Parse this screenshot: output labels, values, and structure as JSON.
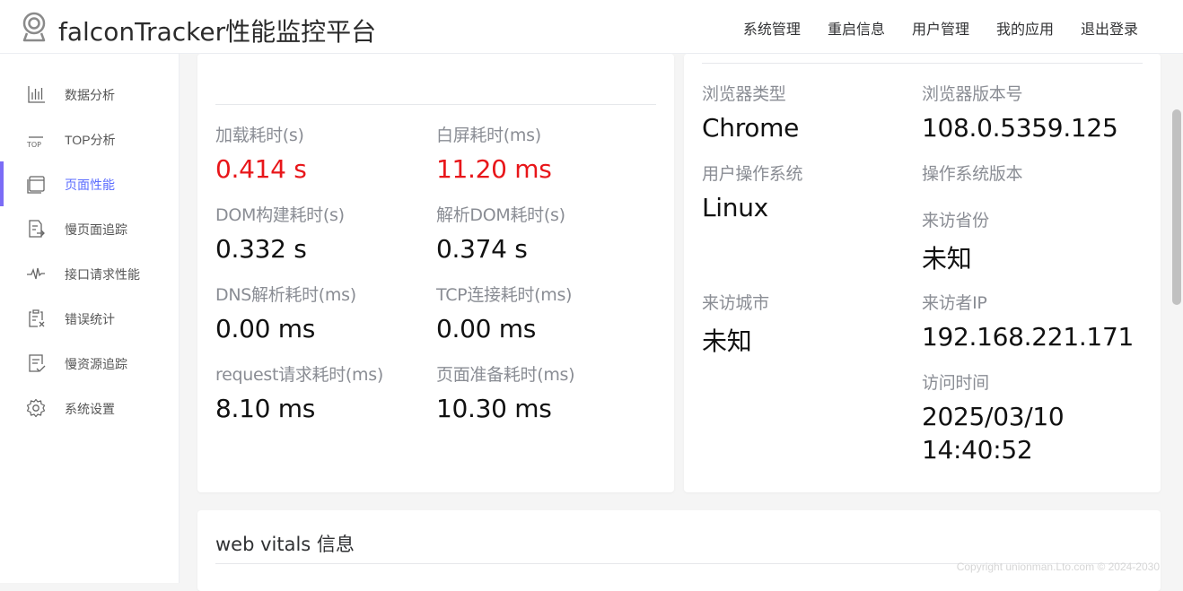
{
  "header": {
    "title": "falconTracker性能监控平台",
    "nav": [
      "系统管理",
      "重启信息",
      "用户管理",
      "我的应用",
      "退出登录"
    ]
  },
  "sidebar": {
    "items": [
      {
        "label": "数据分析",
        "icon": "bar-chart-icon"
      },
      {
        "label": "TOP分析",
        "icon": "top-icon"
      },
      {
        "label": "页面性能",
        "icon": "page-icon",
        "active": true
      },
      {
        "label": "慢页面追踪",
        "icon": "page-track-icon"
      },
      {
        "label": "接口请求性能",
        "icon": "pulse-icon"
      },
      {
        "label": "错误统计",
        "icon": "error-list-icon"
      },
      {
        "label": "慢资源追踪",
        "icon": "resource-check-icon"
      },
      {
        "label": "系统设置",
        "icon": "gear-icon"
      }
    ],
    "accent": "#7b6cf6"
  },
  "perf": {
    "load": {
      "label": "加载耗时(s)",
      "value": "0.414 s"
    },
    "white": {
      "label": "白屏耗时(ms)",
      "value": "11.20 ms"
    },
    "dom_build": {
      "label": "DOM构建耗时(s)",
      "value": "0.332 s"
    },
    "dom_parse": {
      "label": "解析DOM耗时(s)",
      "value": "0.374 s"
    },
    "dns": {
      "label": "DNS解析耗时(ms)",
      "value": "0.00 ms"
    },
    "tcp": {
      "label": "TCP连接耗时(ms)",
      "value": "0.00 ms"
    },
    "request": {
      "label": "request请求耗时(ms)",
      "value": "8.10 ms"
    },
    "ready": {
      "label": "页面准备耗时(ms)",
      "value": "10.30 ms"
    },
    "alert_color": "#e8161a"
  },
  "client": {
    "browser": {
      "label": "浏览器类型",
      "value": "Chrome"
    },
    "browser_version": {
      "label": "浏览器版本号",
      "value": "108.0.5359.125"
    },
    "os": {
      "label": "用户操作系统",
      "value": "Linux"
    },
    "os_version": {
      "label": "操作系统版本",
      "value": ""
    },
    "province": {
      "label": "来访省份",
      "value": "未知"
    },
    "city": {
      "label": "来访城市",
      "value": "未知"
    },
    "ip": {
      "label": "来访者IP",
      "value": "192.168.221.171"
    },
    "visit_time": {
      "label": "访问时间",
      "date": "2025/03/10",
      "time": "14:40:52"
    }
  },
  "vitals": {
    "title": "web vitals 信息"
  },
  "footer": {
    "copyright": "Copyright unionman.Lto.com © 2024-2030"
  }
}
